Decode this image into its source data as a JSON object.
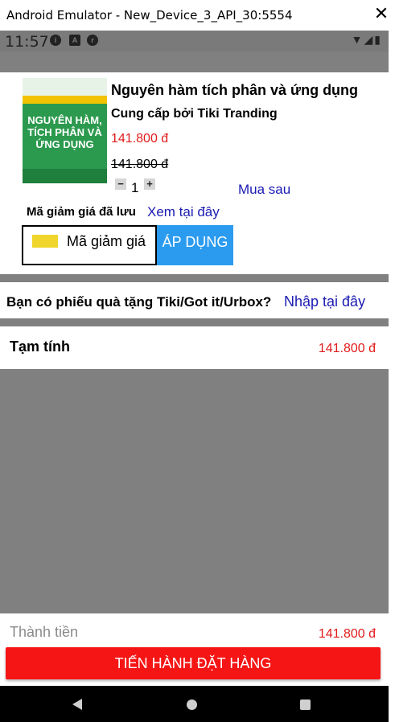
{
  "window": {
    "title": "Android Emulator - New_Device_3_API_30:5554",
    "close_glyph": "✕"
  },
  "status_bar": {
    "time": "11:57",
    "icons": [
      "info-icon",
      "a-icon",
      "app-icon"
    ],
    "right_icons": [
      "wifi-icon",
      "signal-icon",
      "battery-icon"
    ]
  },
  "product": {
    "cover_text": "NGUYÊN HÀM, TÍCH PHÂN VÀ ỨNG DỤNG",
    "title": "Nguyên hàm tích phân và ứng dụng",
    "seller": "Cung cấp bởi Tiki Tranding",
    "price": "141.800 đ",
    "old_price": "141.800 đ",
    "quantity": "1",
    "buy_later": "Mua sau"
  },
  "coupon": {
    "saved_label": "Mã giảm giá đã lưu",
    "view_link": "Xem tại đây",
    "placeholder": "Mã giảm giá",
    "apply_label": "ÁP DỤNG"
  },
  "gift": {
    "question": "Bạn có phiếu quà tặng Tiki/Got it/Urbox?",
    "link": "Nhập tại đây"
  },
  "subtotal": {
    "label": "Tạm tính",
    "value": "141.800 đ"
  },
  "footer": {
    "total_label": "Thành tiền",
    "total_value": "141.800 đ",
    "order_button": "TIẾN HÀNH ĐẶT HÀNG"
  },
  "colors": {
    "accent_red": "#f51515",
    "price_red": "#e21b1b",
    "link_blue": "#1b1bb3",
    "apply_blue": "#2b9bf0"
  }
}
